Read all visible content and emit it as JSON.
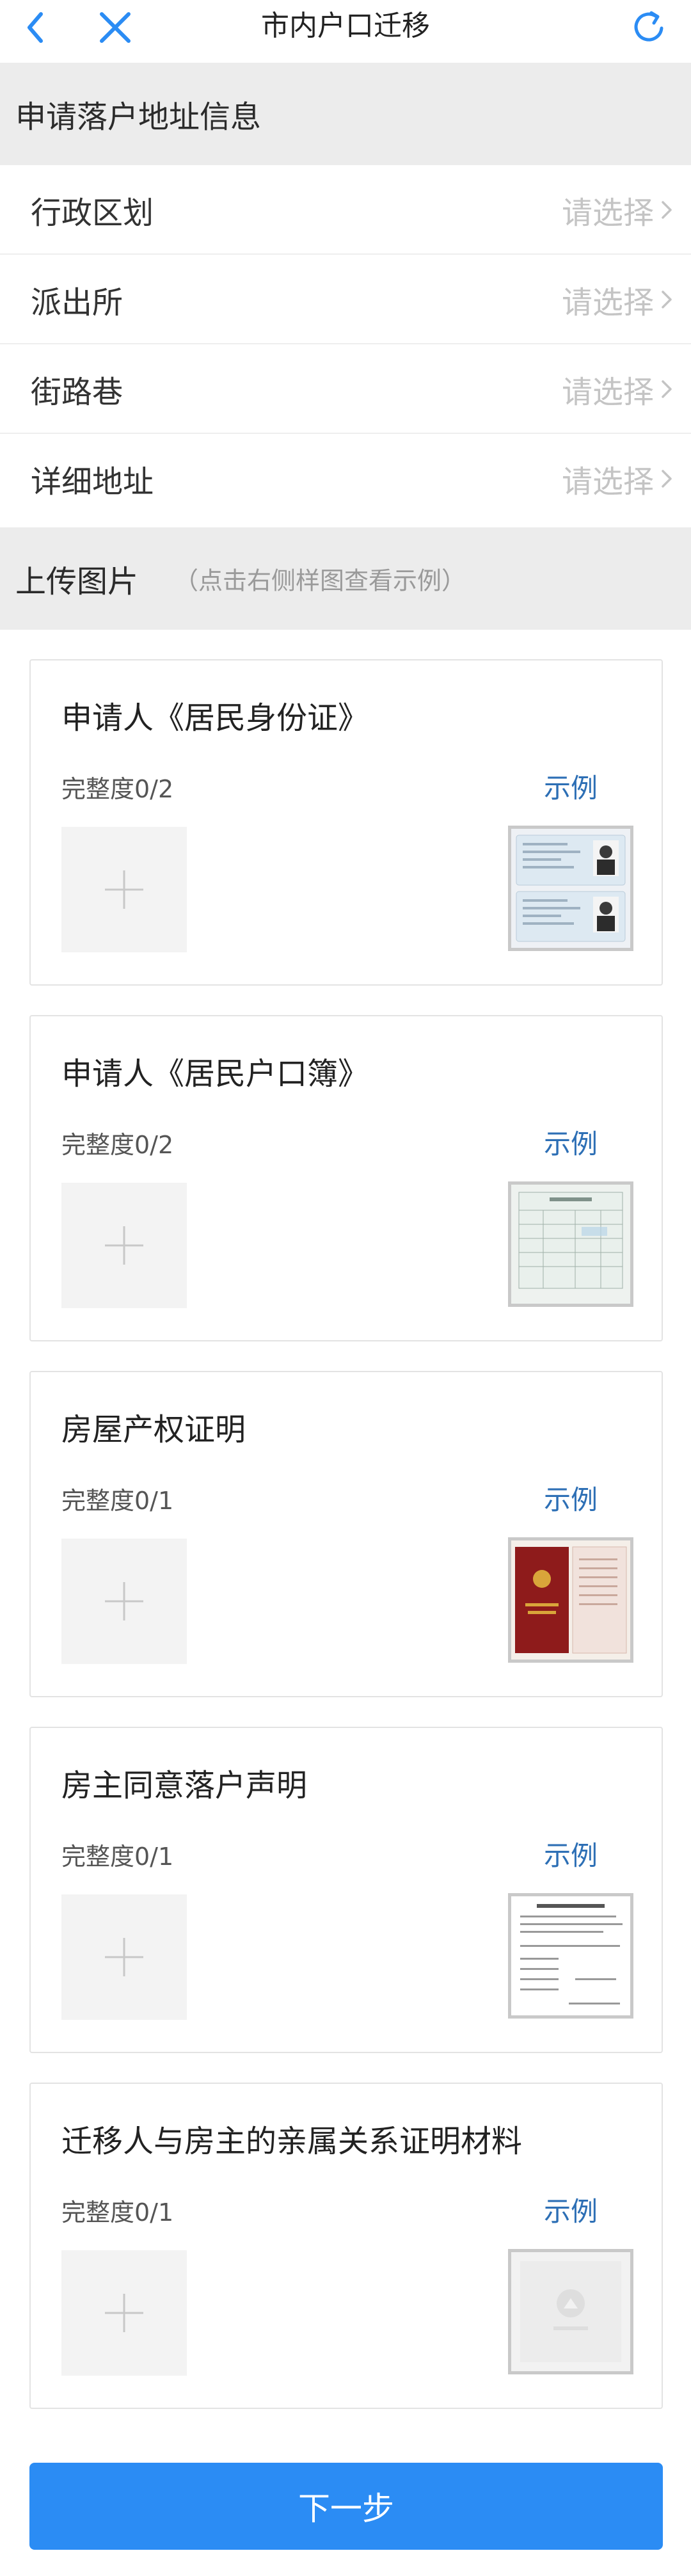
{
  "header": {
    "title": "市内户口迁移",
    "back_icon": "chevron-left-icon",
    "close_icon": "close-icon",
    "refresh_icon": "refresh-icon",
    "accent_color": "#2b8cf4"
  },
  "address_section": {
    "title": "申请落户地址信息",
    "rows": [
      {
        "label": "行政区划",
        "placeholder": "请选择"
      },
      {
        "label": "派出所",
        "placeholder": "请选择"
      },
      {
        "label": "街路巷",
        "placeholder": "请选择"
      },
      {
        "label": "详细地址",
        "placeholder": "请选择"
      }
    ]
  },
  "upload_section": {
    "title": "上传图片",
    "hint": "（点击右侧样图查看示例）",
    "cards": [
      {
        "title": "申请人《居民身份证》",
        "progress": "完整度0/2",
        "example_label": "示例"
      },
      {
        "title": "申请人《居民户口簿》",
        "progress": "完整度0/2",
        "example_label": "示例"
      },
      {
        "title": "房屋产权证明",
        "progress": "完整度0/1",
        "example_label": "示例"
      },
      {
        "title": "房主同意落户声明",
        "progress": "完整度0/1",
        "example_label": "示例"
      },
      {
        "title": "迁移人与房主的亲属关系证明材料",
        "progress": "完整度0/1",
        "example_label": "示例"
      }
    ]
  },
  "footer": {
    "next_label": "下一步"
  }
}
